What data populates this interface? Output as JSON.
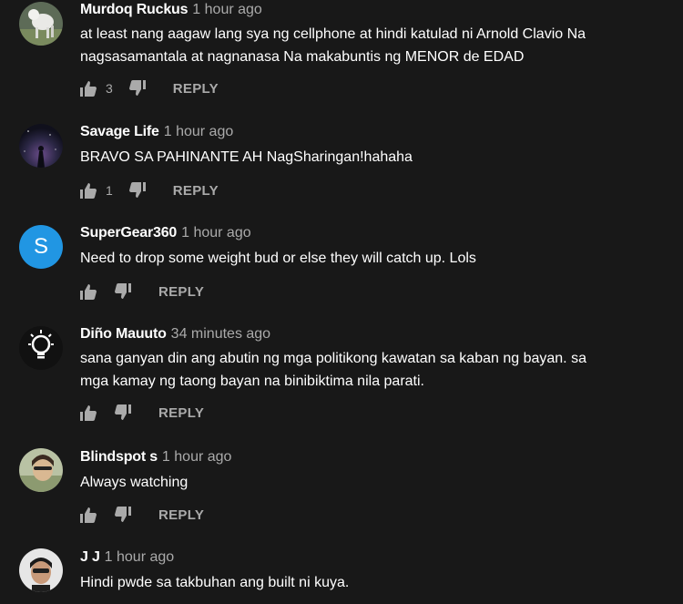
{
  "comments": [
    {
      "author": "Murdoq Ruckus",
      "time": "1 hour ago",
      "lines": [
        "at least nang aagaw lang sya ng cellphone at hindi katulad ni Arnold Clavio Na",
        "nagsasamantala at nagnanasa Na makabuntis ng MENOR de EDAD"
      ],
      "likes": "3",
      "reply": "REPLY"
    },
    {
      "author": "Savage Life",
      "time": "1 hour ago",
      "lines": [
        "BRAVO SA PAHINANTE AH NagSharingan!hahaha"
      ],
      "likes": "1",
      "reply": "REPLY"
    },
    {
      "author": "SuperGear360",
      "time": "1 hour ago",
      "avatar_letter": "S",
      "avatar_color": "#2196e3",
      "lines": [
        "Need to drop some weight bud or else they will catch up. Lols"
      ],
      "likes": "",
      "reply": "REPLY"
    },
    {
      "author": "Diño Mauuto",
      "time": "34 minutes ago",
      "lines": [
        "sana ganyan din ang abutin ng mga politikong kawatan sa kaban ng bayan. sa",
        "mga kamay ng taong bayan na binibiktima nila parati."
      ],
      "likes": "",
      "reply": "REPLY"
    },
    {
      "author": "Blindspot s",
      "time": "1 hour ago",
      "lines": [
        "Always watching"
      ],
      "likes": "",
      "reply": "REPLY"
    },
    {
      "author": "J J",
      "time": "1 hour ago",
      "lines": [
        "Hindi pwde sa takbuhan ang built ni kuya."
      ],
      "likes": "",
      "reply": ""
    }
  ]
}
